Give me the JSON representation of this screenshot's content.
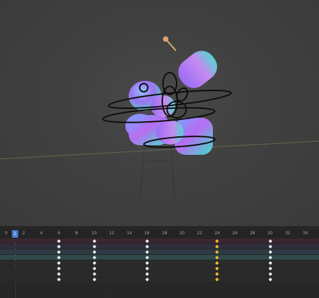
{
  "timeline": {
    "ruler_labels": [
      "0",
      "1",
      "2",
      "4",
      "6",
      "8",
      "10",
      "12",
      "14",
      "16",
      "18",
      "20",
      "22",
      "24",
      "26",
      "28",
      "30",
      "32",
      "34"
    ],
    "current_frame": "1",
    "keyframe_frames": [
      6,
      10,
      16,
      24,
      30
    ],
    "selected_frame": 24
  },
  "colors": {
    "playhead": "#4c7fd6",
    "selected_key": "#f2b632",
    "key": "#e8e8e8"
  }
}
